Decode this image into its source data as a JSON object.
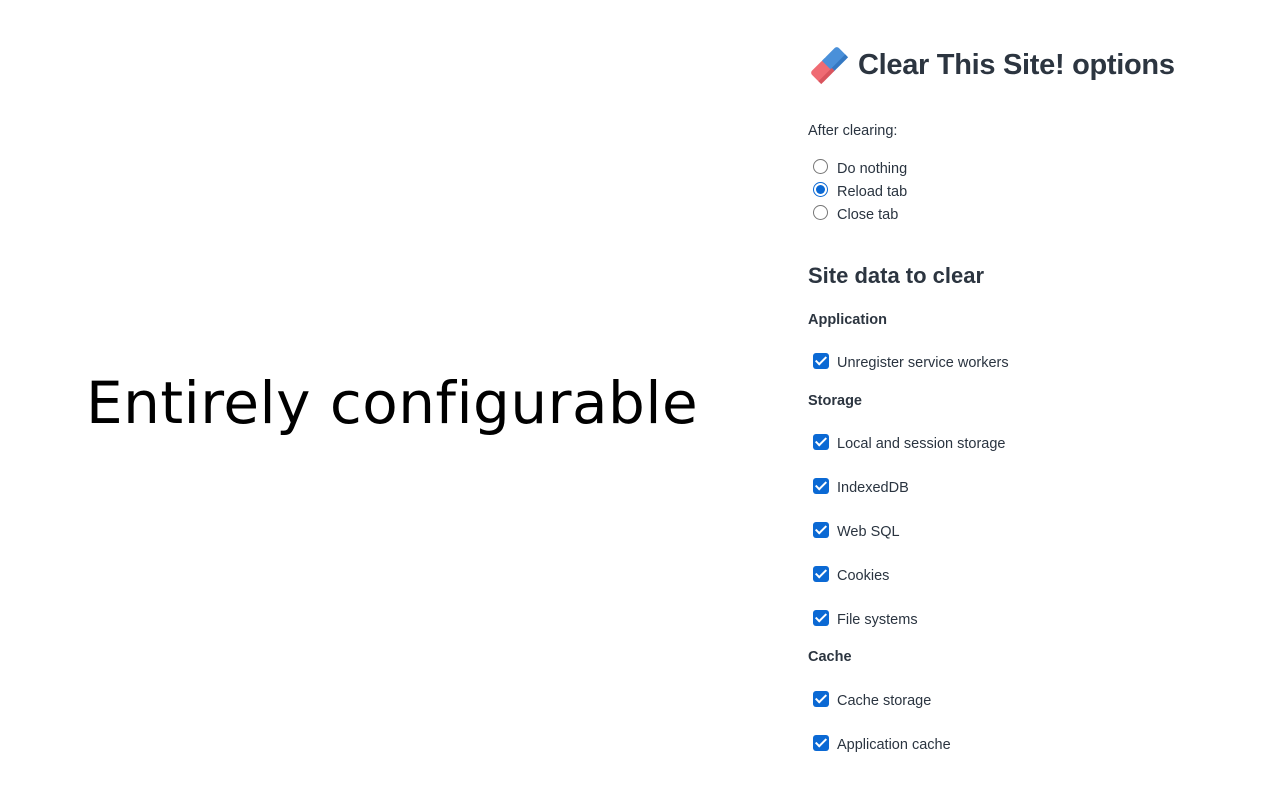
{
  "promo": {
    "tagline": "Entirely configurable"
  },
  "options": {
    "icon": "eraser-icon",
    "title": "Clear This Site! options",
    "after_clearing": {
      "label": "After clearing:",
      "choices": [
        {
          "label": "Do nothing",
          "checked": false
        },
        {
          "label": "Reload tab",
          "checked": true
        },
        {
          "label": "Close tab",
          "checked": false
        }
      ]
    },
    "site_data_heading": "Site data to clear",
    "groups": {
      "application": {
        "heading": "Application",
        "items": [
          {
            "label": "Unregister service workers",
            "checked": true
          }
        ]
      },
      "storage": {
        "heading": "Storage",
        "items": [
          {
            "label": "Local and session storage",
            "checked": true
          },
          {
            "label": "IndexedDB",
            "checked": true
          },
          {
            "label": "Web SQL",
            "checked": true
          },
          {
            "label": "Cookies",
            "checked": true
          },
          {
            "label": "File systems",
            "checked": true
          }
        ]
      },
      "cache": {
        "heading": "Cache",
        "items": [
          {
            "label": "Cache storage",
            "checked": true
          },
          {
            "label": "Application cache",
            "checked": true
          }
        ]
      }
    }
  },
  "colors": {
    "accent": "#0b69d4",
    "heading_text": "#2c3540",
    "body_text": "#2a3440",
    "eraser_blue": "#4a90d9",
    "eraser_red": "#ef6b73"
  }
}
